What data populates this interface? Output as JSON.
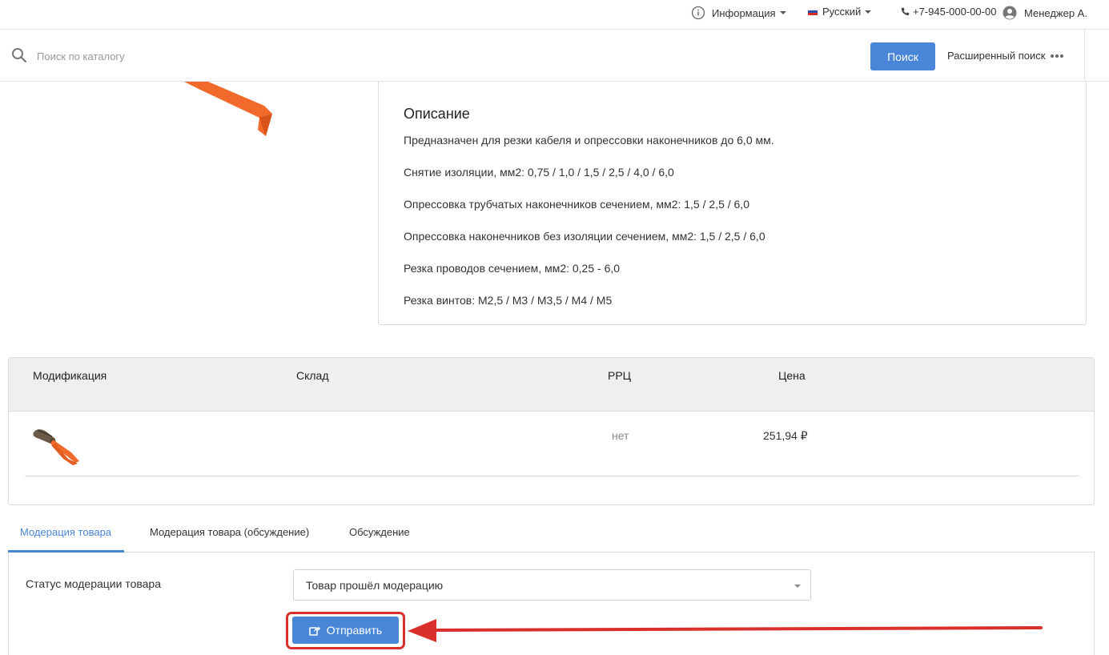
{
  "topbar": {
    "info_label": "Информация",
    "language_label": "Русский",
    "phone": "+7-945-000-00-00",
    "user_name": "Менеджер А."
  },
  "search": {
    "placeholder": "Поиск по каталогу",
    "button_label": "Поиск",
    "advanced_label": "Расширенный поиск"
  },
  "description": {
    "title": "Описание",
    "lines": [
      "Предназначен для резки кабеля и опрессовки наконечников до 6,0 мм.",
      "Снятие изоляции, мм2: 0,75 / 1,0 / 1,5 / 2,5 / 4,0 / 6,0",
      "Опрессовка трубчатых наконечников сечением, мм2: 1,5 / 2,5 / 6,0",
      "Опрессовка наконечников без изоляции сечением, мм2: 1,5 / 2,5 / 6,0",
      "Резка проводов сечением, мм2: 0,25 - 6,0",
      "Резка винтов: М2,5 / М3 / М3,5 / М4 / М5"
    ]
  },
  "modifications": {
    "columns": [
      "Модификация",
      "Склад",
      "РРЦ",
      "Цена"
    ],
    "rows": [
      {
        "rrc": "нет",
        "price": "251,94 ₽"
      }
    ]
  },
  "tabs": [
    {
      "label": "Модерация товара",
      "active": true
    },
    {
      "label": "Модерация товара (обсуждение)",
      "active": false
    },
    {
      "label": "Обсуждение",
      "active": false
    }
  ],
  "moderation": {
    "status_label": "Статус модерации товара",
    "status_value": "Товар прошёл модерацию",
    "submit_label": "Отправить"
  },
  "colors": {
    "accent": "#4a86d8",
    "annotation_red": "#d9302c",
    "tool_orange": "#f26a2b"
  }
}
